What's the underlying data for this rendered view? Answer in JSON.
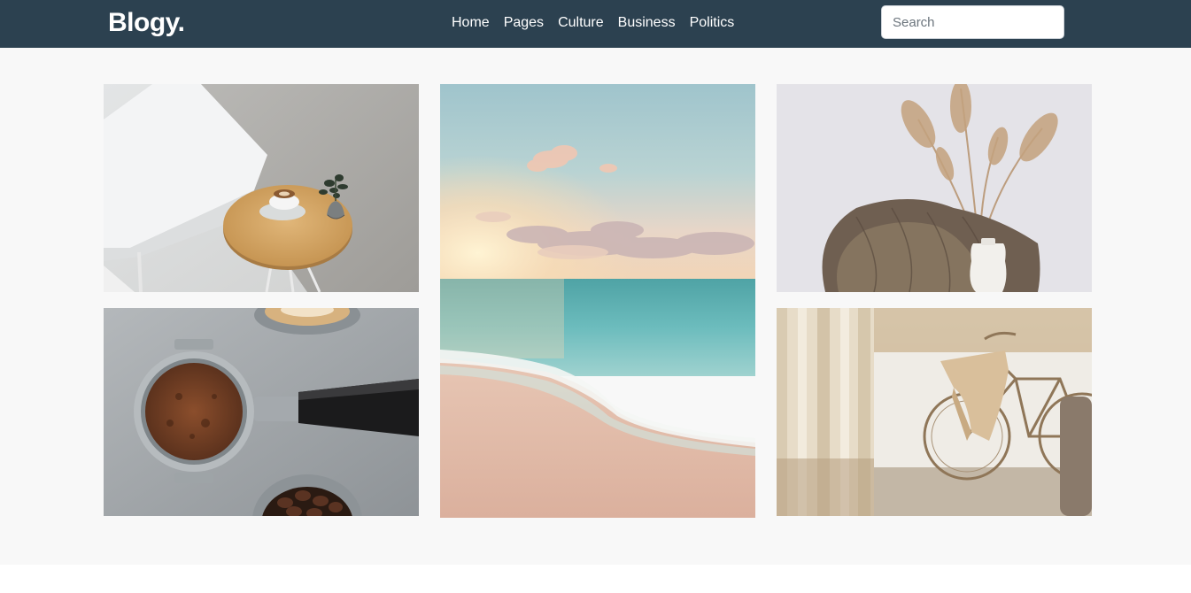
{
  "header": {
    "brand": "Blogy.",
    "nav_items": [
      "Home",
      "Pages",
      "Culture",
      "Business",
      "Politics"
    ],
    "search_placeholder": "Search"
  },
  "gallery": {
    "images": [
      {
        "subject": "coffee cup on round wooden table beside white chair"
      },
      {
        "subject": "beach shoreline at sunset"
      },
      {
        "subject": "dried pampas grass in white vase with knit blanket"
      },
      {
        "subject": "espresso portafilter with ground coffee and beans"
      },
      {
        "subject": "vintage bicycle beside sheer curtains"
      }
    ]
  },
  "colors": {
    "navbar": "#2c4150",
    "page_background": "#f8f8f8"
  }
}
